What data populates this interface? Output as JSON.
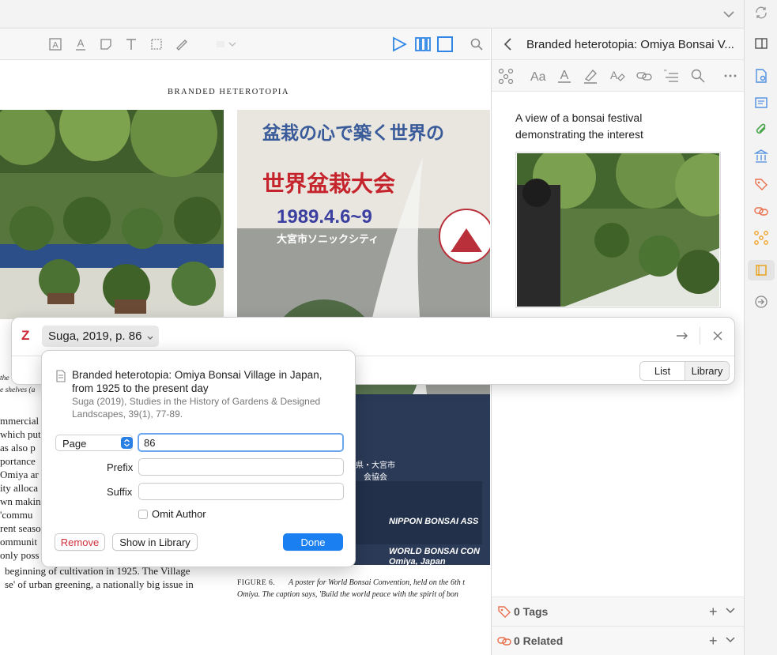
{
  "pdf": {
    "running_head": "BRANDED HETEROTOPIA",
    "left_text_lines": [
      "mmercial",
      "which put",
      "as also p",
      "portance",
      "Omiya ar",
      "ity alloca",
      "wn makin",
      "'commu",
      "rent seaso",
      "ommunit",
      "only poss"
    ],
    "left_caption": [
      "the",
      "e shelves (a"
    ],
    "para_bottom_1": "beginning of cultivation in 1925. The Village",
    "para_bottom_2": "se' of urban greening, a nationally big issue in",
    "figure_label": "FIGURE 6.",
    "figure_caption_1": "A poster for World Bonsai Convention, held on the 6th t",
    "figure_caption_2": "Omiya. The caption says, 'Build the world peace with the spirit of bon",
    "poster": {
      "line1": "盆栽の心で築く世界の",
      "line2": "世界盆栽大会",
      "date": "1989.4.6~9",
      "venue": "大宮市ソニックシティ",
      "bottom1": "WORLD BONSAI CON",
      "bottom2": "Omiya, Japan",
      "bottom3": "NIPPON BONSAI ASS",
      "bottom_jp1": "玉県・大宮市",
      "bottom_jp2": "会協会"
    }
  },
  "right_pane": {
    "title": "Branded heterotopia: Omiya Bonsai V...",
    "annotation_text": "A view of a bonsai festival demonstrating the interest",
    "tags_label": "0 Tags",
    "related_label": "0 Related"
  },
  "citation": {
    "logo": "Z",
    "chip_label": "Suga, 2019, p. 86",
    "list_label": "List",
    "library_label": "Library",
    "item_title": "Branded heterotopia: Omiya Bonsai Village in Japan, from 1925 to the present day",
    "item_source": "Suga (2019), Studies in the History of Gardens & Designed Landscapes, 39(1), 77-89.",
    "locator_label": "Page",
    "locator_value": "86",
    "prefix_label": "Prefix",
    "prefix_value": "",
    "suffix_label": "Suffix",
    "suffix_value": "",
    "omit_author_label": "Omit Author",
    "remove_label": "Remove",
    "show_in_library_label": "Show in Library",
    "done_label": "Done"
  },
  "colors": {
    "accent": "#1a7ff0",
    "zotero_red": "#cc2936",
    "remove_red": "#d0303c",
    "icon_blue": "#4e8fe0"
  }
}
